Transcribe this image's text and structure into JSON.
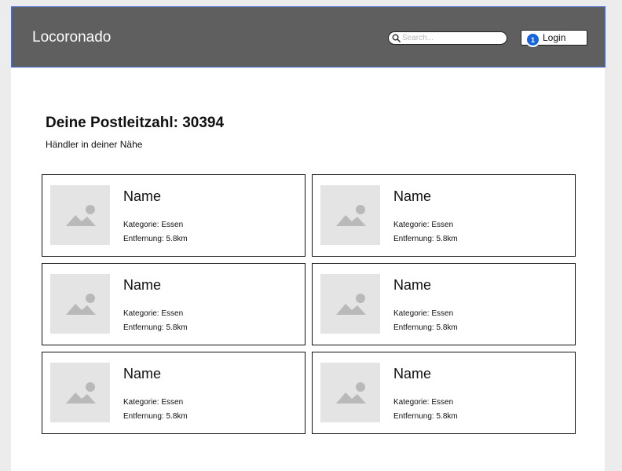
{
  "header": {
    "brand": "Locoronado",
    "search_placeholder": "Search...",
    "login_label": "Login",
    "login_badge": "1"
  },
  "main": {
    "zip_heading": "Deine Postleitzahl: 30394",
    "subtitle": "Händler in deiner Nähe"
  },
  "merchants": [
    {
      "name": "Name",
      "category": "Kategorie: Essen",
      "distance": "Entfernung: 5.8km",
      "image_icon": "image-placeholder-icon"
    },
    {
      "name": "Name",
      "category": "Kategorie: Essen",
      "distance": "Entfernung: 5.8km",
      "image_icon": "image-placeholder-icon"
    },
    {
      "name": "Name",
      "category": "Kategorie: Essen",
      "distance": "Entfernung: 5.8km",
      "image_icon": "image-placeholder-icon"
    },
    {
      "name": "Name",
      "category": "Kategorie: Essen",
      "distance": "Entfernung: 5.8km",
      "image_icon": "image-placeholder-icon"
    },
    {
      "name": "Name",
      "category": "Kategorie: Essen",
      "distance": "Entfernung: 5.8km",
      "image_icon": "image-placeholder-icon"
    },
    {
      "name": "Name",
      "category": "Kategorie: Essen",
      "distance": "Entfernung: 5.8km",
      "image_icon": "image-placeholder-icon"
    }
  ],
  "colors": {
    "navbar_bg": "#5f5f5f",
    "navbar_border": "#4a6fd6",
    "badge_bg": "#1464e0",
    "placeholder_bg": "#e4e4e4",
    "page_bg": "#ececec"
  }
}
